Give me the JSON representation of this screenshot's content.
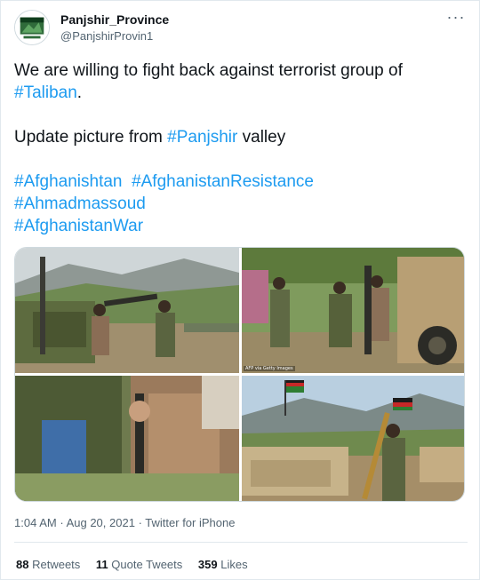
{
  "author": {
    "display_name": "Panjshir_Province",
    "handle": "@PanjshirProvin1"
  },
  "more_menu_label": "···",
  "tweet": {
    "line1_text": "We are willing to fight back against terrorist group of",
    "line1_hashtag": "#Taliban",
    "line1_after": ".",
    "line2_text": "Update picture from",
    "line2_hashtag": "#Panjshir",
    "line2_after": "valley",
    "hashtags": [
      "#Afghanishtan",
      "#AfghanistanResistance",
      "#Ahmadmassoud",
      "#AfghanistanWar"
    ]
  },
  "media": {
    "photo_credit": "AFP via Getty Images"
  },
  "meta": {
    "time": "1:04 AM",
    "date": "Aug 20, 2021",
    "separator": "·",
    "source": "Twitter for iPhone"
  },
  "stats": {
    "retweets_count": "88",
    "retweets_label": "Retweets",
    "quotes_count": "11",
    "quotes_label": "Quote Tweets",
    "likes_count": "359",
    "likes_label": "Likes"
  },
  "colors": {
    "link": "#1d9bf0",
    "text": "#0f1419",
    "secondary": "#536471",
    "border": "#e1e8ed"
  }
}
